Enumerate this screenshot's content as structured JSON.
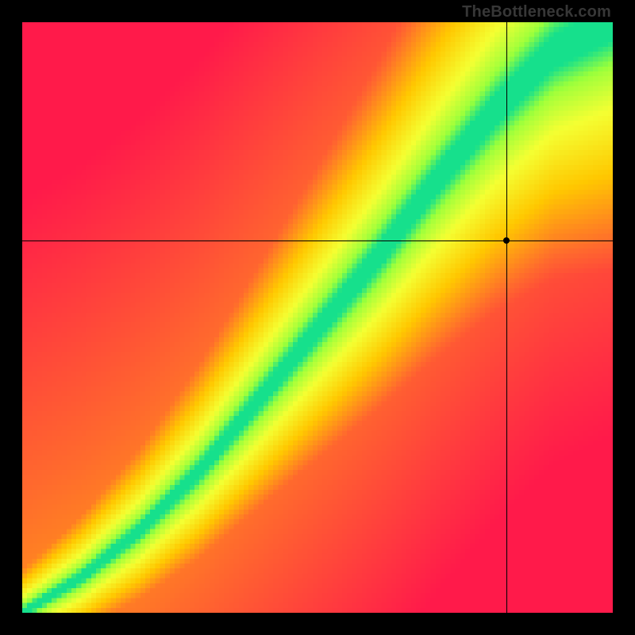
{
  "watermark": "TheBottleneck.com",
  "chart_data": {
    "type": "heatmap",
    "title": "",
    "xlabel": "",
    "ylabel": "",
    "xlim": [
      0,
      100
    ],
    "ylim": [
      0,
      100
    ],
    "grid": false,
    "legend": false,
    "notes": "Value at (x, y) represents compatibility/fit percentage. 100 = green optimal band along a slightly super-linear diagonal; falls off toward red in both off-diagonal directions. Color scale roughly: 0→#ff1a4a, 25→#ff6a2d, 50→#ffc800, 75→#f4ff32, 90→#97ff3c, 100→#16e08c.",
    "crosshair": {
      "x": 82,
      "y": 63
    },
    "marker": {
      "x": 82,
      "y": 63
    },
    "optimal_band_samples": [
      {
        "x": 0,
        "y": 0
      },
      {
        "x": 10,
        "y": 6
      },
      {
        "x": 20,
        "y": 14
      },
      {
        "x": 30,
        "y": 24
      },
      {
        "x": 40,
        "y": 36
      },
      {
        "x": 50,
        "y": 48
      },
      {
        "x": 60,
        "y": 60
      },
      {
        "x": 70,
        "y": 73
      },
      {
        "x": 80,
        "y": 85
      },
      {
        "x": 90,
        "y": 95
      },
      {
        "x": 100,
        "y": 100
      }
    ],
    "color_stops": [
      {
        "t": 0.0,
        "hex": "#ff1a4a"
      },
      {
        "t": 0.25,
        "hex": "#ff6a2d"
      },
      {
        "t": 0.5,
        "hex": "#ffc800"
      },
      {
        "t": 0.72,
        "hex": "#f4ff32"
      },
      {
        "t": 0.88,
        "hex": "#97ff3c"
      },
      {
        "t": 1.0,
        "hex": "#16e08c"
      }
    ],
    "pixelation": 120
  }
}
